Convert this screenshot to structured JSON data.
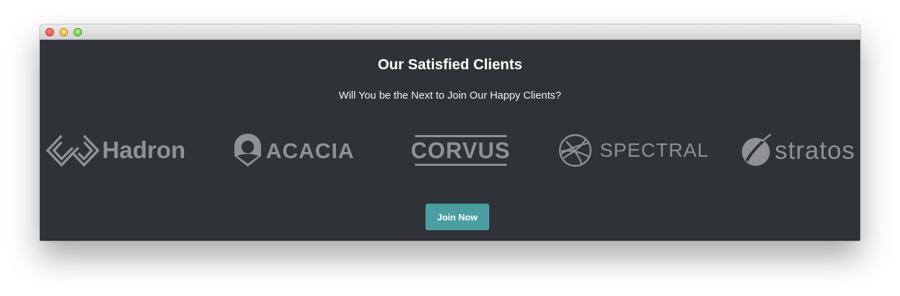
{
  "window": {
    "controls": [
      "close",
      "minimize",
      "zoom"
    ]
  },
  "section": {
    "title": "Our Satisfied Clients",
    "subtitle": "Will You be the Next to Join Our Happy Clients?"
  },
  "clients": [
    {
      "name": "Hadron",
      "icon": "hadron-logo-icon"
    },
    {
      "name": "ACACIA",
      "icon": "acacia-logo-icon"
    },
    {
      "name": "CORVUS",
      "icon": "corvus-logo"
    },
    {
      "name": "SPECTRAL",
      "icon": "spectral-logo-icon"
    },
    {
      "name": "stratos",
      "icon": "stratos-logo-icon"
    }
  ],
  "cta": {
    "label": "Join Now"
  },
  "colors": {
    "background": "#2f3236",
    "logo_gray": "#8f9194",
    "button": "#4a9ea1",
    "text": "#ffffff"
  }
}
